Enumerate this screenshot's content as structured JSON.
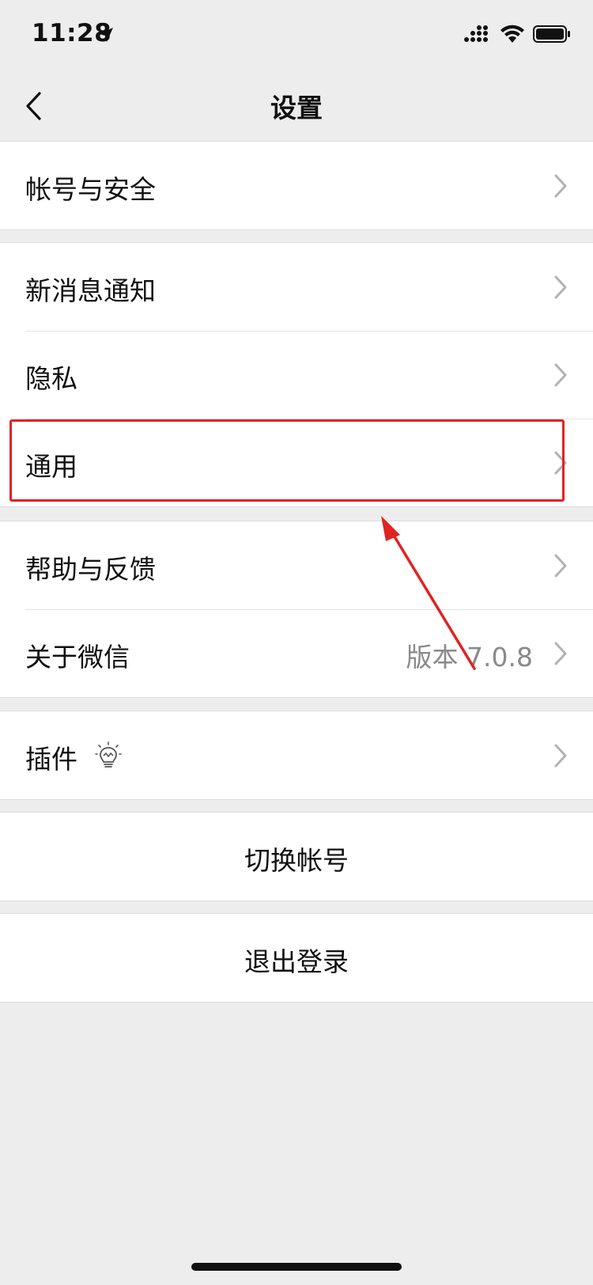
{
  "status_bar": {
    "time": "11:28"
  },
  "nav": {
    "title": "设置"
  },
  "groups": [
    {
      "items": [
        {
          "label": "帐号与安全"
        }
      ]
    },
    {
      "items": [
        {
          "label": "新消息通知"
        },
        {
          "label": "隐私"
        },
        {
          "label": "通用"
        }
      ]
    },
    {
      "items": [
        {
          "label": "帮助与反馈"
        },
        {
          "label": "关于微信",
          "value": "版本 7.0.8"
        }
      ]
    },
    {
      "items": [
        {
          "label": "插件",
          "icon": "lightbulb-icon"
        }
      ]
    }
  ],
  "actions": {
    "switch_account": "切换帐号",
    "logout": "退出登录"
  },
  "colors": {
    "background": "#ededed",
    "cell_background": "#ffffff",
    "annotation": "#e32222",
    "secondary_text": "#8a8a8a"
  }
}
